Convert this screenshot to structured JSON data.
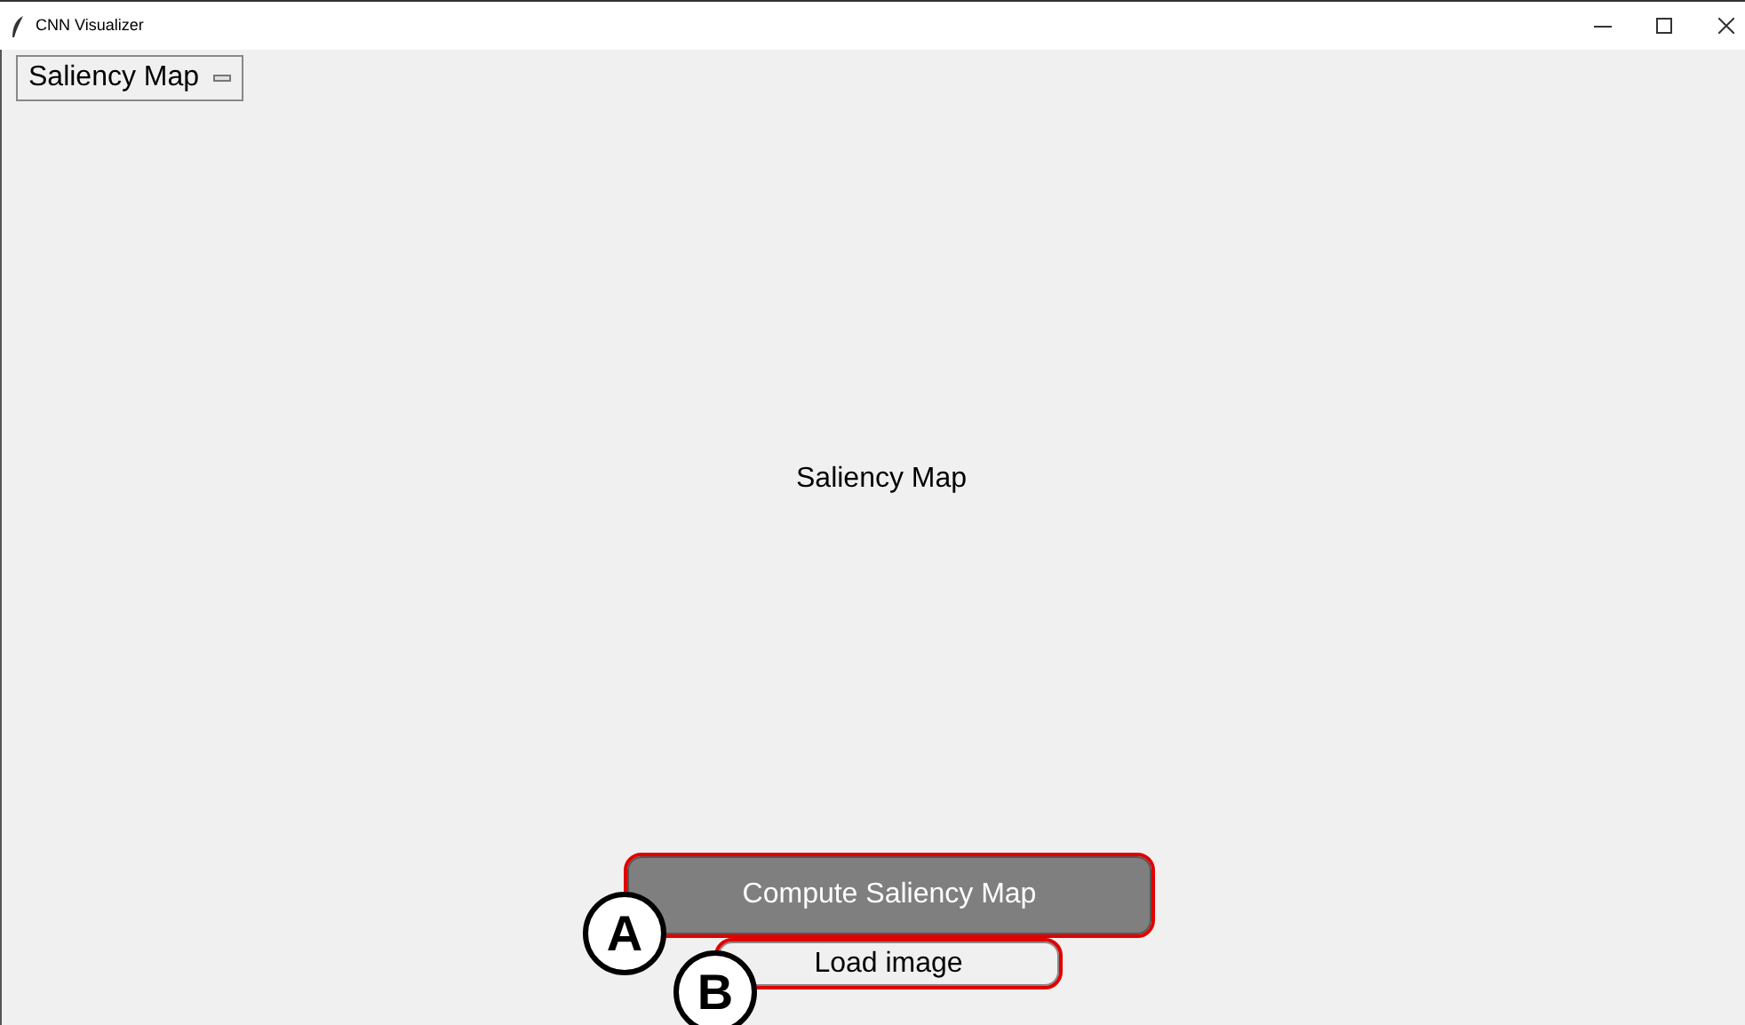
{
  "window": {
    "title": "CNN Visualizer"
  },
  "option_menu": {
    "value": "Saliency Map"
  },
  "label": "Saliency Map",
  "buttons": [
    {
      "label": "Compute Saliency Map",
      "kind": "primary",
      "callout": "A"
    },
    {
      "label": "Load image",
      "kind": "plain",
      "callout": "B"
    }
  ]
}
